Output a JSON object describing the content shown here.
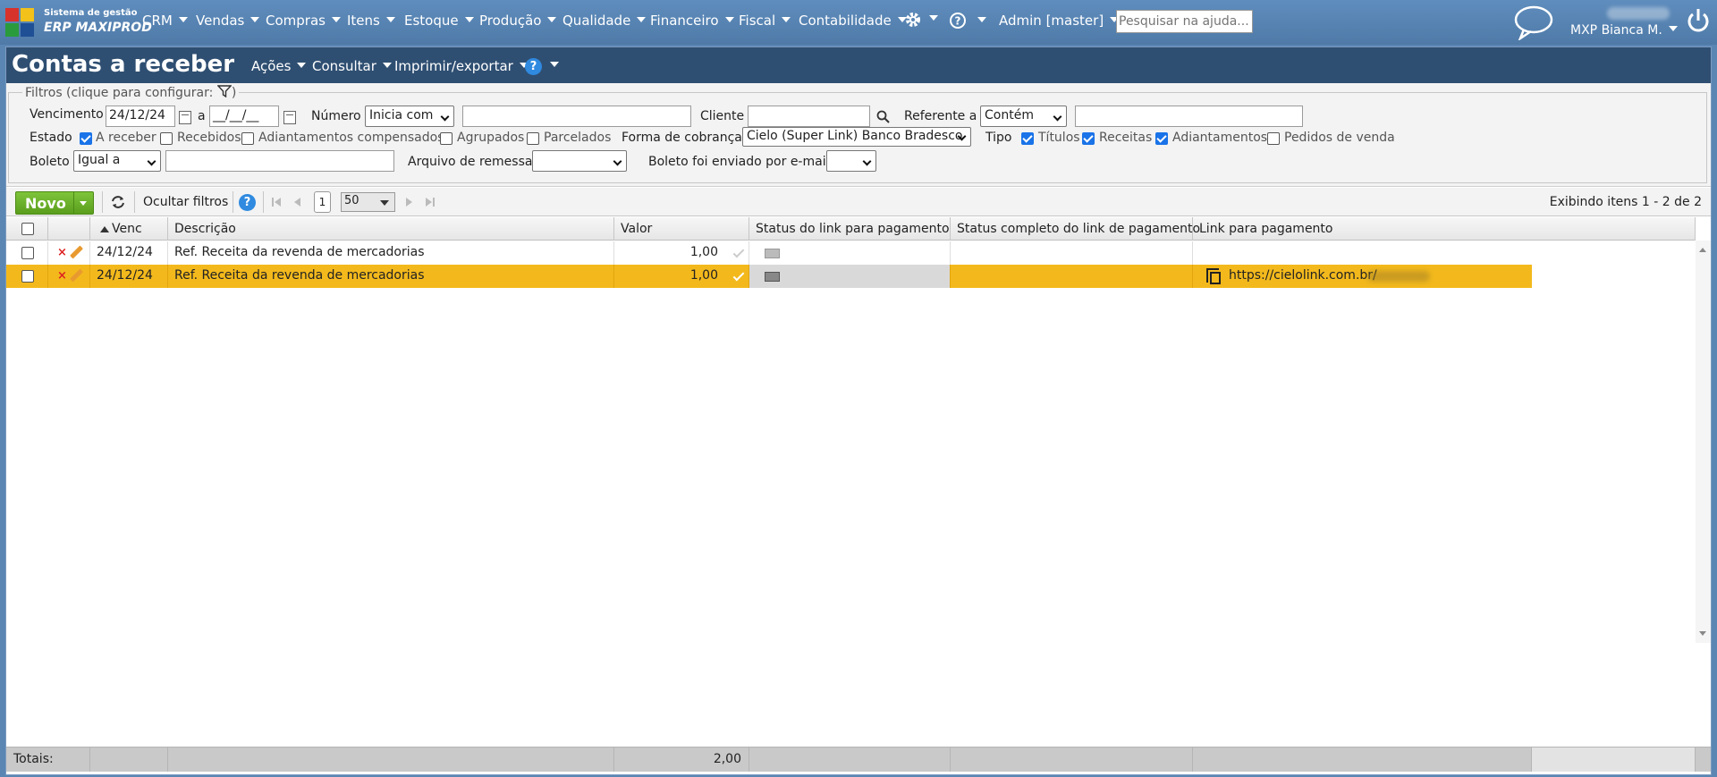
{
  "topbar": {
    "logo_line1": "Sistema de gestão",
    "logo_line2": "ERP MAXIPROD",
    "menus": [
      "CRM",
      "Vendas",
      "Compras",
      "Itens",
      "Estoque",
      "Produção",
      "Qualidade",
      "Financeiro",
      "Fiscal",
      "Contabilidade"
    ],
    "admin": "Admin [master]",
    "help_placeholder": "Pesquisar na ajuda...",
    "user": "MXP Bianca M."
  },
  "page": {
    "title": "Contas a receber",
    "menus": [
      "Ações",
      "Consultar",
      "Imprimir/exportar"
    ]
  },
  "filters": {
    "legend": "Filtros (clique para configurar:",
    "legend_end": ")",
    "vencimento_label": "Vencimento",
    "venc_from": "24/12/24",
    "venc_to_label": "a",
    "venc_to": "__/__/__",
    "numero_label": "Número",
    "numero_op": "Inicia com",
    "numero_value": "",
    "cliente_label": "Cliente",
    "cliente_value": "",
    "referente_label": "Referente a",
    "referente_op": "Contém",
    "referente_value": "",
    "estado_label": "Estado",
    "estado_options": [
      {
        "label": "A receber",
        "checked": true
      },
      {
        "label": "Recebidos",
        "checked": false
      },
      {
        "label": "Adiantamentos compensados",
        "checked": false
      },
      {
        "label": "Agrupados",
        "checked": false
      },
      {
        "label": "Parcelados",
        "checked": false
      }
    ],
    "forma_label": "Forma de cobrança",
    "forma_value": "Cielo (Super Link) Banco Bradesco",
    "tipo_label": "Tipo",
    "tipo_options": [
      {
        "label": "Títulos",
        "checked": true
      },
      {
        "label": "Receitas",
        "checked": true
      },
      {
        "label": "Adiantamentos",
        "checked": true
      },
      {
        "label": "Pedidos de venda",
        "checked": false
      }
    ],
    "boleto_label": "Boleto",
    "boleto_op": "Igual a",
    "boleto_value": "",
    "arquivo_label": "Arquivo de remessa",
    "arquivo_value": "",
    "email_label": "Boleto foi enviado por e-mail",
    "email_value": ""
  },
  "toolbar": {
    "novo": "Novo",
    "ocultar": "Ocultar filtros",
    "page": "1",
    "page_size": "50",
    "info": "Exibindo itens 1 - 2 de 2"
  },
  "grid": {
    "headers": {
      "venc": "Venc",
      "descricao": "Descrição",
      "valor": "Valor",
      "status_link": "Status do link para pagamento",
      "status_completo": "Status completo do link de pagamento",
      "link": "Link para pagamento"
    },
    "rows": [
      {
        "venc": "24/12/24",
        "descricao": "Ref. Receita da revenda de mercadorias",
        "valor": "1,00",
        "link": ""
      },
      {
        "venc": "24/12/24",
        "descricao": "Ref. Receita da revenda de mercadorias",
        "valor": "1,00",
        "link": "https://cielolink.com.br/"
      }
    ],
    "totals_label": "Totais:",
    "totals_valor": "2,00"
  },
  "colors": {
    "selected_row": "#f3b91c",
    "title_bar": "#2f4f72",
    "top_bar": "#5b86b4",
    "novo": "#6aae27"
  }
}
